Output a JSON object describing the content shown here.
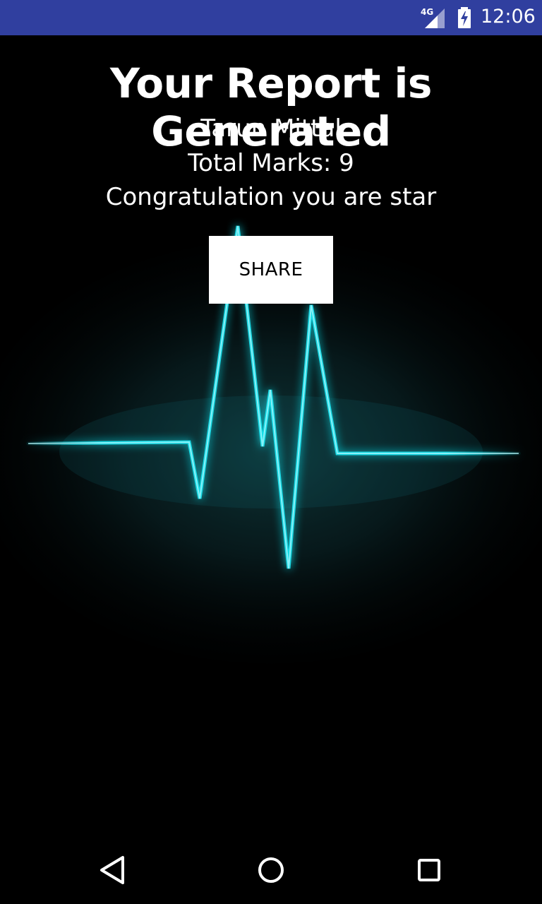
{
  "status_bar": {
    "network_label": "4G",
    "time": "12:06",
    "icons": [
      "signal-icon",
      "battery-charging-icon"
    ],
    "background": "#303f9f"
  },
  "report": {
    "title": "Your Report is Generated",
    "name": "Tarun Mittal",
    "total_marks": "Total Marks: 9",
    "message": "Congratulation you are star",
    "share_label": "SHARE"
  },
  "navigation": {
    "icons": [
      "back-icon",
      "home-icon",
      "recents-icon"
    ]
  },
  "colors": {
    "pulse": "#17e6f2",
    "background": "#000000",
    "button": "#ffffff"
  }
}
